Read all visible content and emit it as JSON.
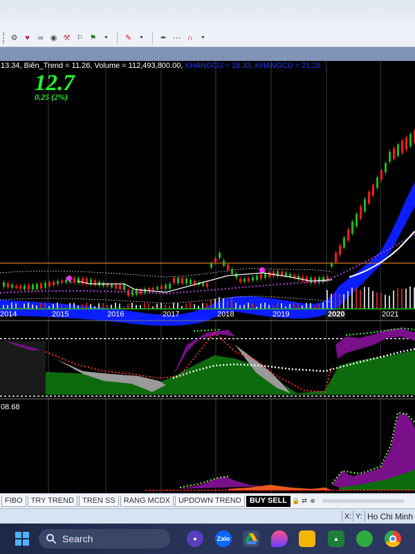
{
  "toolbar": {
    "icons": [
      "gear-icon",
      "heart-icon",
      "glasses-icon",
      "binoculars-icon",
      "hammer-icon",
      "pin-icon",
      "flag-icon",
      "dropdown-icon",
      "pen-icon",
      "dropdown-icon",
      "line-tool-icon",
      "dotted-line-icon",
      "magnet-icon",
      "dropdown-icon"
    ]
  },
  "price_info": {
    "prefix": "13.34, ",
    "trend_text": "Biên_Trend = 11.26, Volume = 112,493,800.00, ",
    "kv1_text": "KHANGCU = 18.33, ",
    "kv2_text": "KHANGCU = 21.26"
  },
  "big_price": "12.7",
  "big_change": "0.25 (2%)",
  "ind3_value": "08.68",
  "years": [
    "2014",
    "2015",
    "2016",
    "2017",
    "2018",
    "2019",
    "2020",
    "2021"
  ],
  "active_year": "2020",
  "tabs": [
    {
      "label": "FIBO",
      "active": false
    },
    {
      "label": "TRY TREND",
      "active": false
    },
    {
      "label": "TREN SS",
      "active": false
    },
    {
      "label": "RANG MCDX",
      "active": false
    },
    {
      "label": "UPDOWN TREND",
      "active": false
    },
    {
      "label": "BUY SELL",
      "active": true
    }
  ],
  "status": {
    "x_label": "X:",
    "y_label": "Y:",
    "location": "Ho Chi Minh S"
  },
  "taskbar": {
    "search_placeholder": "Search",
    "apps": [
      "camera-app-icon",
      "zalo-app-icon",
      "drive-app-icon",
      "edge-app-icon",
      "file-explorer-icon",
      "stock-app-icon",
      "green-app-icon",
      "chrome-icon"
    ],
    "zalo_label": "Zalo"
  },
  "colors": {
    "candle_up": "#1fb81f",
    "candle_down": "#ff1a1a",
    "band_blue": "#0a1eff",
    "price_green": "#1dff2a",
    "indicator_purple": "#7a0f8a",
    "indicator_green": "#0d6b0d",
    "indicator_gray": "#9a9a9a"
  }
}
